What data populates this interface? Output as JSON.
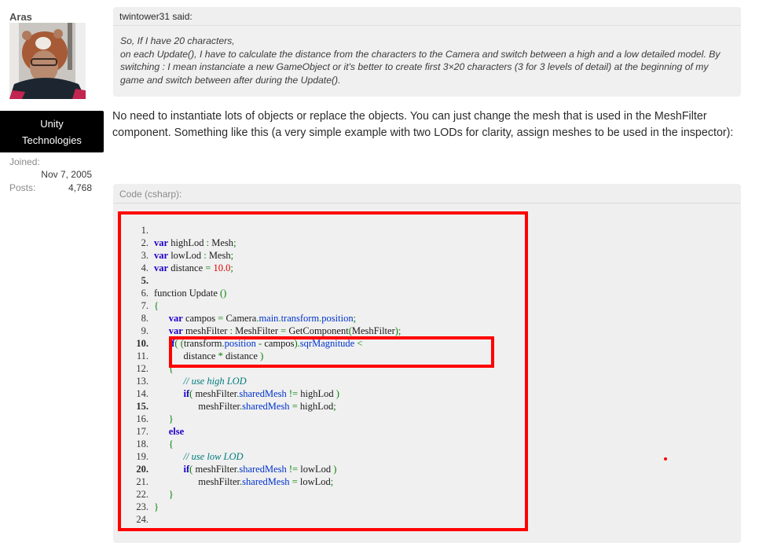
{
  "user": {
    "name": "Aras",
    "avatar_icon": "user-avatar-photo",
    "title_line1": "Unity",
    "title_line2": "Technologies",
    "joined_label": "Joined:",
    "joined_value": "Nov 7, 2005",
    "posts_label": "Posts:",
    "posts_value": "4,768"
  },
  "quote": {
    "author_line": "twintower31 said:",
    "lines": [
      "So, If I have 20 characters,",
      "on each Update(), I have to calculate the distance from the characters to the Camera and switch between a high and a low detailed model. By switching : I mean instanciate a new GameObject or it's better to create first 3×20 characters (3 for 3 levels of detail) at the beginning of my game and switch between after during the Update()."
    ]
  },
  "reply": {
    "text": "No need to instantiate lots of objects or replace the objects. You can just change the mesh that is used in the MeshFilter component. Something like this (a very simple example with two LODs for clarity, assign meshes to be used in the inspector):"
  },
  "code": {
    "header": "Code (csharp):",
    "lines": [
      {
        "n": "1.",
        "bold": false,
        "indent": 0,
        "tokens": []
      },
      {
        "n": "2.",
        "bold": false,
        "indent": 0,
        "tokens": [
          [
            "kw",
            "var"
          ],
          [
            "t",
            " highLod "
          ],
          [
            "punct",
            ":"
          ],
          [
            "t",
            " Mesh"
          ],
          [
            "punct",
            ";"
          ]
        ]
      },
      {
        "n": "3.",
        "bold": false,
        "indent": 0,
        "tokens": [
          [
            "kw",
            "var"
          ],
          [
            "t",
            " lowLod "
          ],
          [
            "punct",
            ":"
          ],
          [
            "t",
            " Mesh"
          ],
          [
            "punct",
            ";"
          ]
        ]
      },
      {
        "n": "4.",
        "bold": false,
        "indent": 0,
        "tokens": [
          [
            "kw",
            "var"
          ],
          [
            "t",
            " distance "
          ],
          [
            "punct",
            "="
          ],
          [
            "t",
            " "
          ],
          [
            "num",
            "10.0"
          ],
          [
            "punct",
            ";"
          ]
        ]
      },
      {
        "n": "5.",
        "bold": true,
        "indent": 0,
        "tokens": []
      },
      {
        "n": "6.",
        "bold": false,
        "indent": 0,
        "tokens": [
          [
            "t",
            "function Update "
          ],
          [
            "punct",
            "()"
          ]
        ]
      },
      {
        "n": "7.",
        "bold": false,
        "indent": 0,
        "tokens": [
          [
            "punct",
            "{"
          ]
        ]
      },
      {
        "n": "8.",
        "bold": false,
        "indent": 1,
        "tokens": [
          [
            "kw",
            "var"
          ],
          [
            "t",
            " campos "
          ],
          [
            "punct",
            "="
          ],
          [
            "t",
            " Camera"
          ],
          [
            "punct",
            "."
          ],
          [
            "prop",
            "main"
          ],
          [
            "punct",
            "."
          ],
          [
            "prop",
            "transform"
          ],
          [
            "punct",
            "."
          ],
          [
            "prop",
            "position"
          ],
          [
            "punct",
            ";"
          ]
        ]
      },
      {
        "n": "9.",
        "bold": false,
        "indent": 1,
        "tokens": [
          [
            "kw",
            "var"
          ],
          [
            "t",
            " meshFilter "
          ],
          [
            "punct",
            ":"
          ],
          [
            "t",
            " MeshFilter "
          ],
          [
            "punct",
            "="
          ],
          [
            "t",
            " GetComponent"
          ],
          [
            "punct",
            "("
          ],
          [
            "t",
            "MeshFilter"
          ],
          [
            "punct",
            ");"
          ]
        ]
      },
      {
        "n": "10.",
        "bold": true,
        "indent": 1,
        "tokens": [
          [
            "kw",
            "if"
          ],
          [
            "punct",
            "("
          ],
          [
            "t",
            " "
          ],
          [
            "punct",
            "("
          ],
          [
            "t",
            "transform"
          ],
          [
            "punct",
            "."
          ],
          [
            "prop",
            "position"
          ],
          [
            "t",
            " "
          ],
          [
            "punct",
            "-"
          ],
          [
            "t",
            " campos"
          ],
          [
            "punct",
            ")."
          ],
          [
            "prop",
            "sqrMagnitude"
          ],
          [
            "t",
            " "
          ],
          [
            "punct",
            "<"
          ]
        ]
      },
      {
        "n": "11.",
        "bold": false,
        "indent": 2,
        "tokens": [
          [
            "t",
            "distance "
          ],
          [
            "punct",
            "*"
          ],
          [
            "t",
            " distance "
          ],
          [
            "punct",
            ")"
          ]
        ]
      },
      {
        "n": "12.",
        "bold": false,
        "indent": 1,
        "tokens": [
          [
            "punct",
            "{"
          ]
        ]
      },
      {
        "n": "13.",
        "bold": false,
        "indent": 2,
        "tokens": [
          [
            "cm",
            "// use high LOD"
          ]
        ]
      },
      {
        "n": "14.",
        "bold": false,
        "indent": 2,
        "tokens": [
          [
            "kw",
            "if"
          ],
          [
            "punct",
            "("
          ],
          [
            "t",
            " meshFilter"
          ],
          [
            "punct",
            "."
          ],
          [
            "prop",
            "sharedMesh"
          ],
          [
            "t",
            " "
          ],
          [
            "punct",
            "!="
          ],
          [
            "t",
            " highLod "
          ],
          [
            "punct",
            ")"
          ]
        ]
      },
      {
        "n": "15.",
        "bold": true,
        "indent": 3,
        "tokens": [
          [
            "t",
            "meshFilter"
          ],
          [
            "punct",
            "."
          ],
          [
            "prop",
            "sharedMesh"
          ],
          [
            "t",
            " "
          ],
          [
            "punct",
            "="
          ],
          [
            "t",
            " highLod"
          ],
          [
            "punct",
            ";"
          ]
        ]
      },
      {
        "n": "16.",
        "bold": false,
        "indent": 1,
        "tokens": [
          [
            "punct",
            "}"
          ]
        ]
      },
      {
        "n": "17.",
        "bold": false,
        "indent": 1,
        "tokens": [
          [
            "kw",
            "else"
          ]
        ]
      },
      {
        "n": "18.",
        "bold": false,
        "indent": 1,
        "tokens": [
          [
            "punct",
            "{"
          ]
        ]
      },
      {
        "n": "19.",
        "bold": false,
        "indent": 2,
        "tokens": [
          [
            "cm",
            "// use low LOD"
          ]
        ]
      },
      {
        "n": "20.",
        "bold": true,
        "indent": 2,
        "tokens": [
          [
            "kw",
            "if"
          ],
          [
            "punct",
            "("
          ],
          [
            "t",
            " meshFilter"
          ],
          [
            "punct",
            "."
          ],
          [
            "prop",
            "sharedMesh"
          ],
          [
            "t",
            " "
          ],
          [
            "punct",
            "!="
          ],
          [
            "t",
            " lowLod "
          ],
          [
            "punct",
            ")"
          ]
        ]
      },
      {
        "n": "21.",
        "bold": false,
        "indent": 3,
        "tokens": [
          [
            "t",
            "meshFilter"
          ],
          [
            "punct",
            "."
          ],
          [
            "prop",
            "sharedMesh"
          ],
          [
            "t",
            " "
          ],
          [
            "punct",
            "="
          ],
          [
            "t",
            " lowLod"
          ],
          [
            "punct",
            ";"
          ]
        ]
      },
      {
        "n": "22.",
        "bold": false,
        "indent": 1,
        "tokens": [
          [
            "punct",
            "}"
          ]
        ]
      },
      {
        "n": "23.",
        "bold": false,
        "indent": 0,
        "tokens": [
          [
            "punct",
            "}"
          ]
        ]
      },
      {
        "n": "24.",
        "bold": false,
        "indent": 0,
        "tokens": []
      }
    ]
  },
  "annotations": {
    "highlight_color": "#ff0000",
    "outer_box": "code-listing-annotation",
    "inner_box": "if-condition-annotation",
    "dot": "red-marker-dot"
  },
  "colors": {
    "keyword": "#1b00cc",
    "property": "#0033cc",
    "number": "#e00000",
    "punctuation": "#008000",
    "comment": "#007b7b",
    "quote_bg": "#f0f0f0",
    "title_bg": "#000000"
  }
}
